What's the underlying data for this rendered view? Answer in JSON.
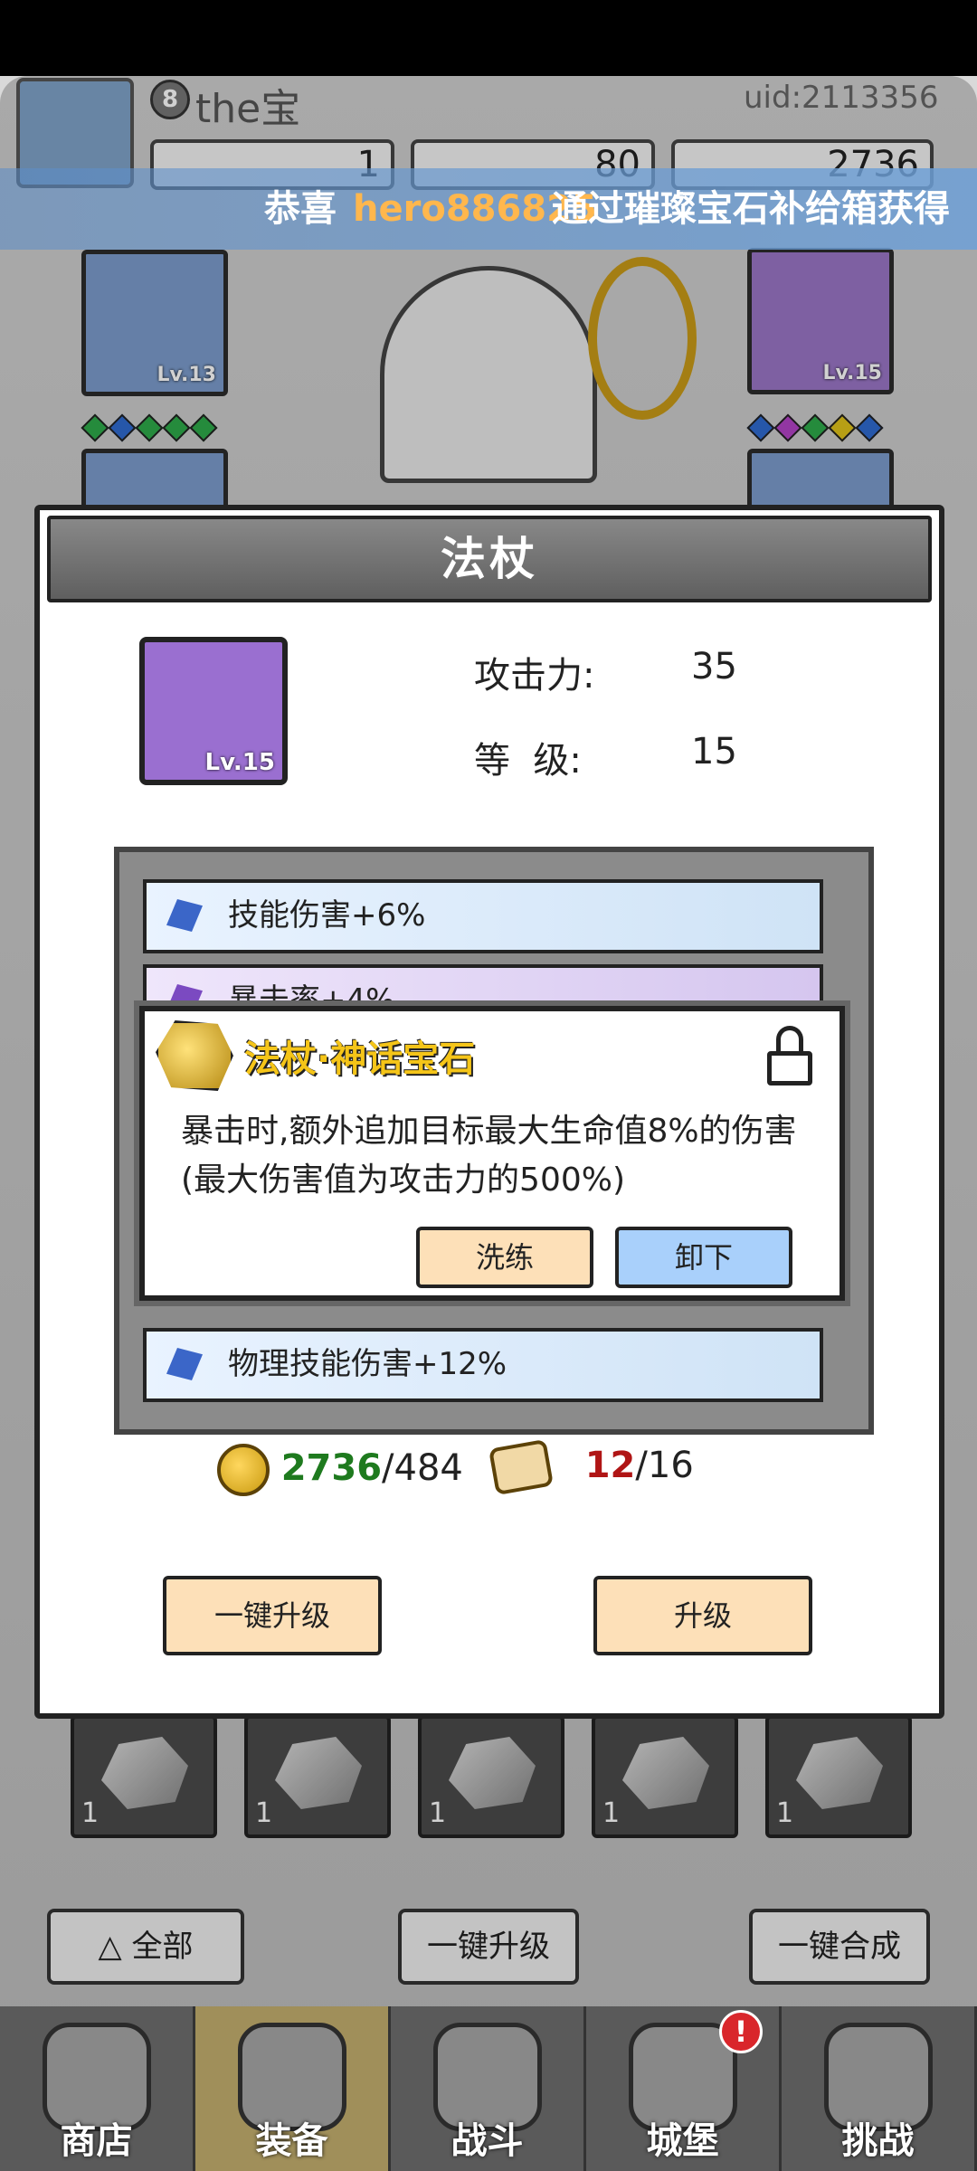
{
  "header": {
    "player_level": "8",
    "player_name": "the宝",
    "uid": "uid:2113356",
    "resources": [
      "1",
      "80",
      "2736"
    ]
  },
  "marquee": {
    "prefix": "恭喜",
    "player": "hero886825",
    "suffix": "通过璀璨宝石补给箱获得"
  },
  "slots": {
    "left_lv": "Lv.13",
    "right_lv": "Lv.15"
  },
  "modal": {
    "title": "法杖",
    "item_lv": "Lv.15",
    "attack_label": "攻击力:",
    "attack_value": "35",
    "level_label": "等  级:",
    "level_value": "15",
    "gems": [
      {
        "text": "技能伤害+6%"
      },
      {
        "text": "暴击率+4%"
      },
      {
        "text": "物理技能伤害+12%"
      }
    ],
    "popup": {
      "title": "法杖·神话宝石",
      "description": "暴击时,额外追加目标最大生命值8%的伤害(最大伤害值为攻击力的500%)",
      "reforge_label": "洗练",
      "unequip_label": "卸下"
    },
    "cost": {
      "gold_have": "2736",
      "gold_need": "/484",
      "scroll_have": "12",
      "scroll_need": "/16"
    },
    "one_key_upgrade_label": "一键升级",
    "upgrade_label": "升级"
  },
  "stones": [
    {
      "count": "1"
    },
    {
      "count": "1"
    },
    {
      "count": "1"
    },
    {
      "count": "1"
    },
    {
      "count": "1"
    }
  ],
  "bottom_buttons": {
    "all_label": "全部",
    "one_key_upgrade_label": "一键升级",
    "one_key_merge_label": "一键合成"
  },
  "nav": [
    {
      "label": "商店"
    },
    {
      "label": "装备"
    },
    {
      "label": "战斗"
    },
    {
      "label": "城堡"
    },
    {
      "label": "挑战"
    }
  ],
  "colors": {
    "accent_gold": "#f5c518",
    "gold_green": "#1e7a1e",
    "scroll_red": "#b01515",
    "marquee_highlight": "#ffb74d"
  }
}
